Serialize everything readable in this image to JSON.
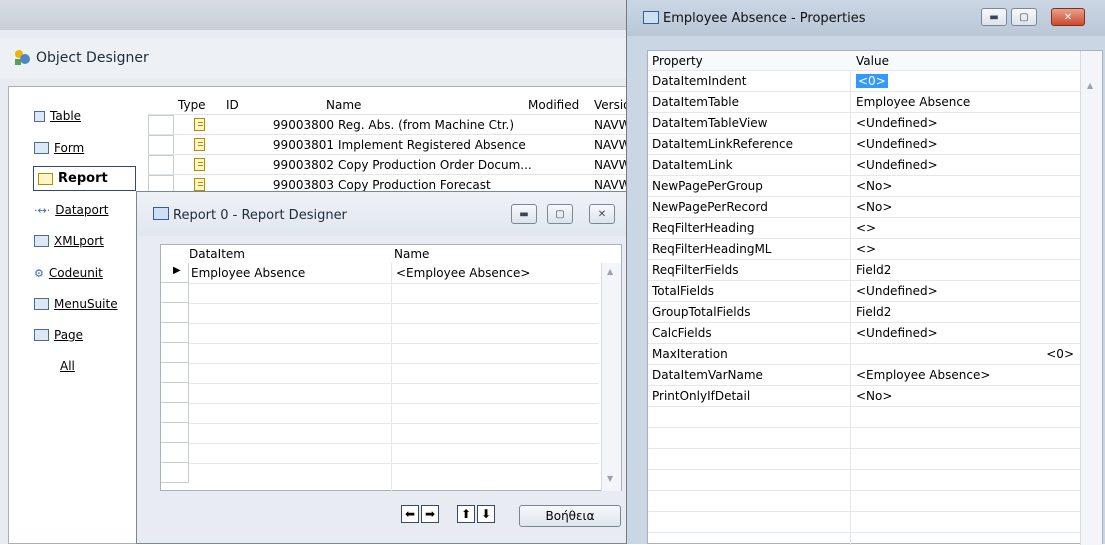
{
  "object_designer": {
    "title": "Object Designer",
    "nav": [
      {
        "label": "Table",
        "icon": "table-icon"
      },
      {
        "label": "Form",
        "icon": "form-icon"
      },
      {
        "label": "Report",
        "icon": "report-icon",
        "selected": true
      },
      {
        "label": "Dataport",
        "icon": "dataport-icon"
      },
      {
        "label": "XMLport",
        "icon": "xmlport-icon"
      },
      {
        "label": "Codeunit",
        "icon": "codeunit-icon"
      },
      {
        "label": "MenuSuite",
        "icon": "menusuite-icon"
      },
      {
        "label": "Page",
        "icon": "page-icon"
      },
      {
        "label": "All",
        "icon": ""
      }
    ],
    "columns": {
      "type": "Type",
      "id": "ID",
      "name": "Name",
      "modified": "Modified",
      "version": "Versio"
    },
    "rows": [
      {
        "id": "99003800",
        "name": "Reg. Abs. (from Machine Ctr.)",
        "version": "NAVW"
      },
      {
        "id": "99003801",
        "name": "Implement Registered Absence",
        "version": "NAVW"
      },
      {
        "id": "99003802",
        "name": "Copy Production Order Docum...",
        "version": "NAVW"
      },
      {
        "id": "99003803",
        "name": "Copy Production Forecast",
        "version": "NAVW"
      }
    ]
  },
  "report_designer": {
    "title": "Report 0 - Report Designer",
    "columns": {
      "dataitem": "DataItem",
      "name": "Name"
    },
    "row": {
      "dataitem": "Employee Absence",
      "name": "<Employee Absence>"
    },
    "help_label": "Βοήθεια"
  },
  "properties": {
    "title": "Employee Absence - Properties",
    "columns": {
      "property": "Property",
      "value": "Value"
    },
    "rows": [
      {
        "property": "DataItemIndent",
        "value": "<0>"
      },
      {
        "property": "DataItemTable",
        "value": "Employee Absence"
      },
      {
        "property": "DataItemTableView",
        "value": "<Undefined>"
      },
      {
        "property": "DataItemLinkReference",
        "value": "<Undefined>"
      },
      {
        "property": "DataItemLink",
        "value": "<Undefined>"
      },
      {
        "property": "NewPagePerGroup",
        "value": "<No>"
      },
      {
        "property": "NewPagePerRecord",
        "value": "<No>"
      },
      {
        "property": "ReqFilterHeading",
        "value": "<>"
      },
      {
        "property": "ReqFilterHeadingML",
        "value": "<>"
      },
      {
        "property": "ReqFilterFields",
        "value": "Field2"
      },
      {
        "property": "TotalFields",
        "value": "<Undefined>"
      },
      {
        "property": "GroupTotalFields",
        "value": "Field2"
      },
      {
        "property": "CalcFields",
        "value": "<Undefined>"
      },
      {
        "property": "MaxIteration",
        "value": "<0>"
      },
      {
        "property": "DataItemVarName",
        "value": "<Employee Absence>"
      },
      {
        "property": "PrintOnlyIfDetail",
        "value": "<No>"
      }
    ]
  }
}
